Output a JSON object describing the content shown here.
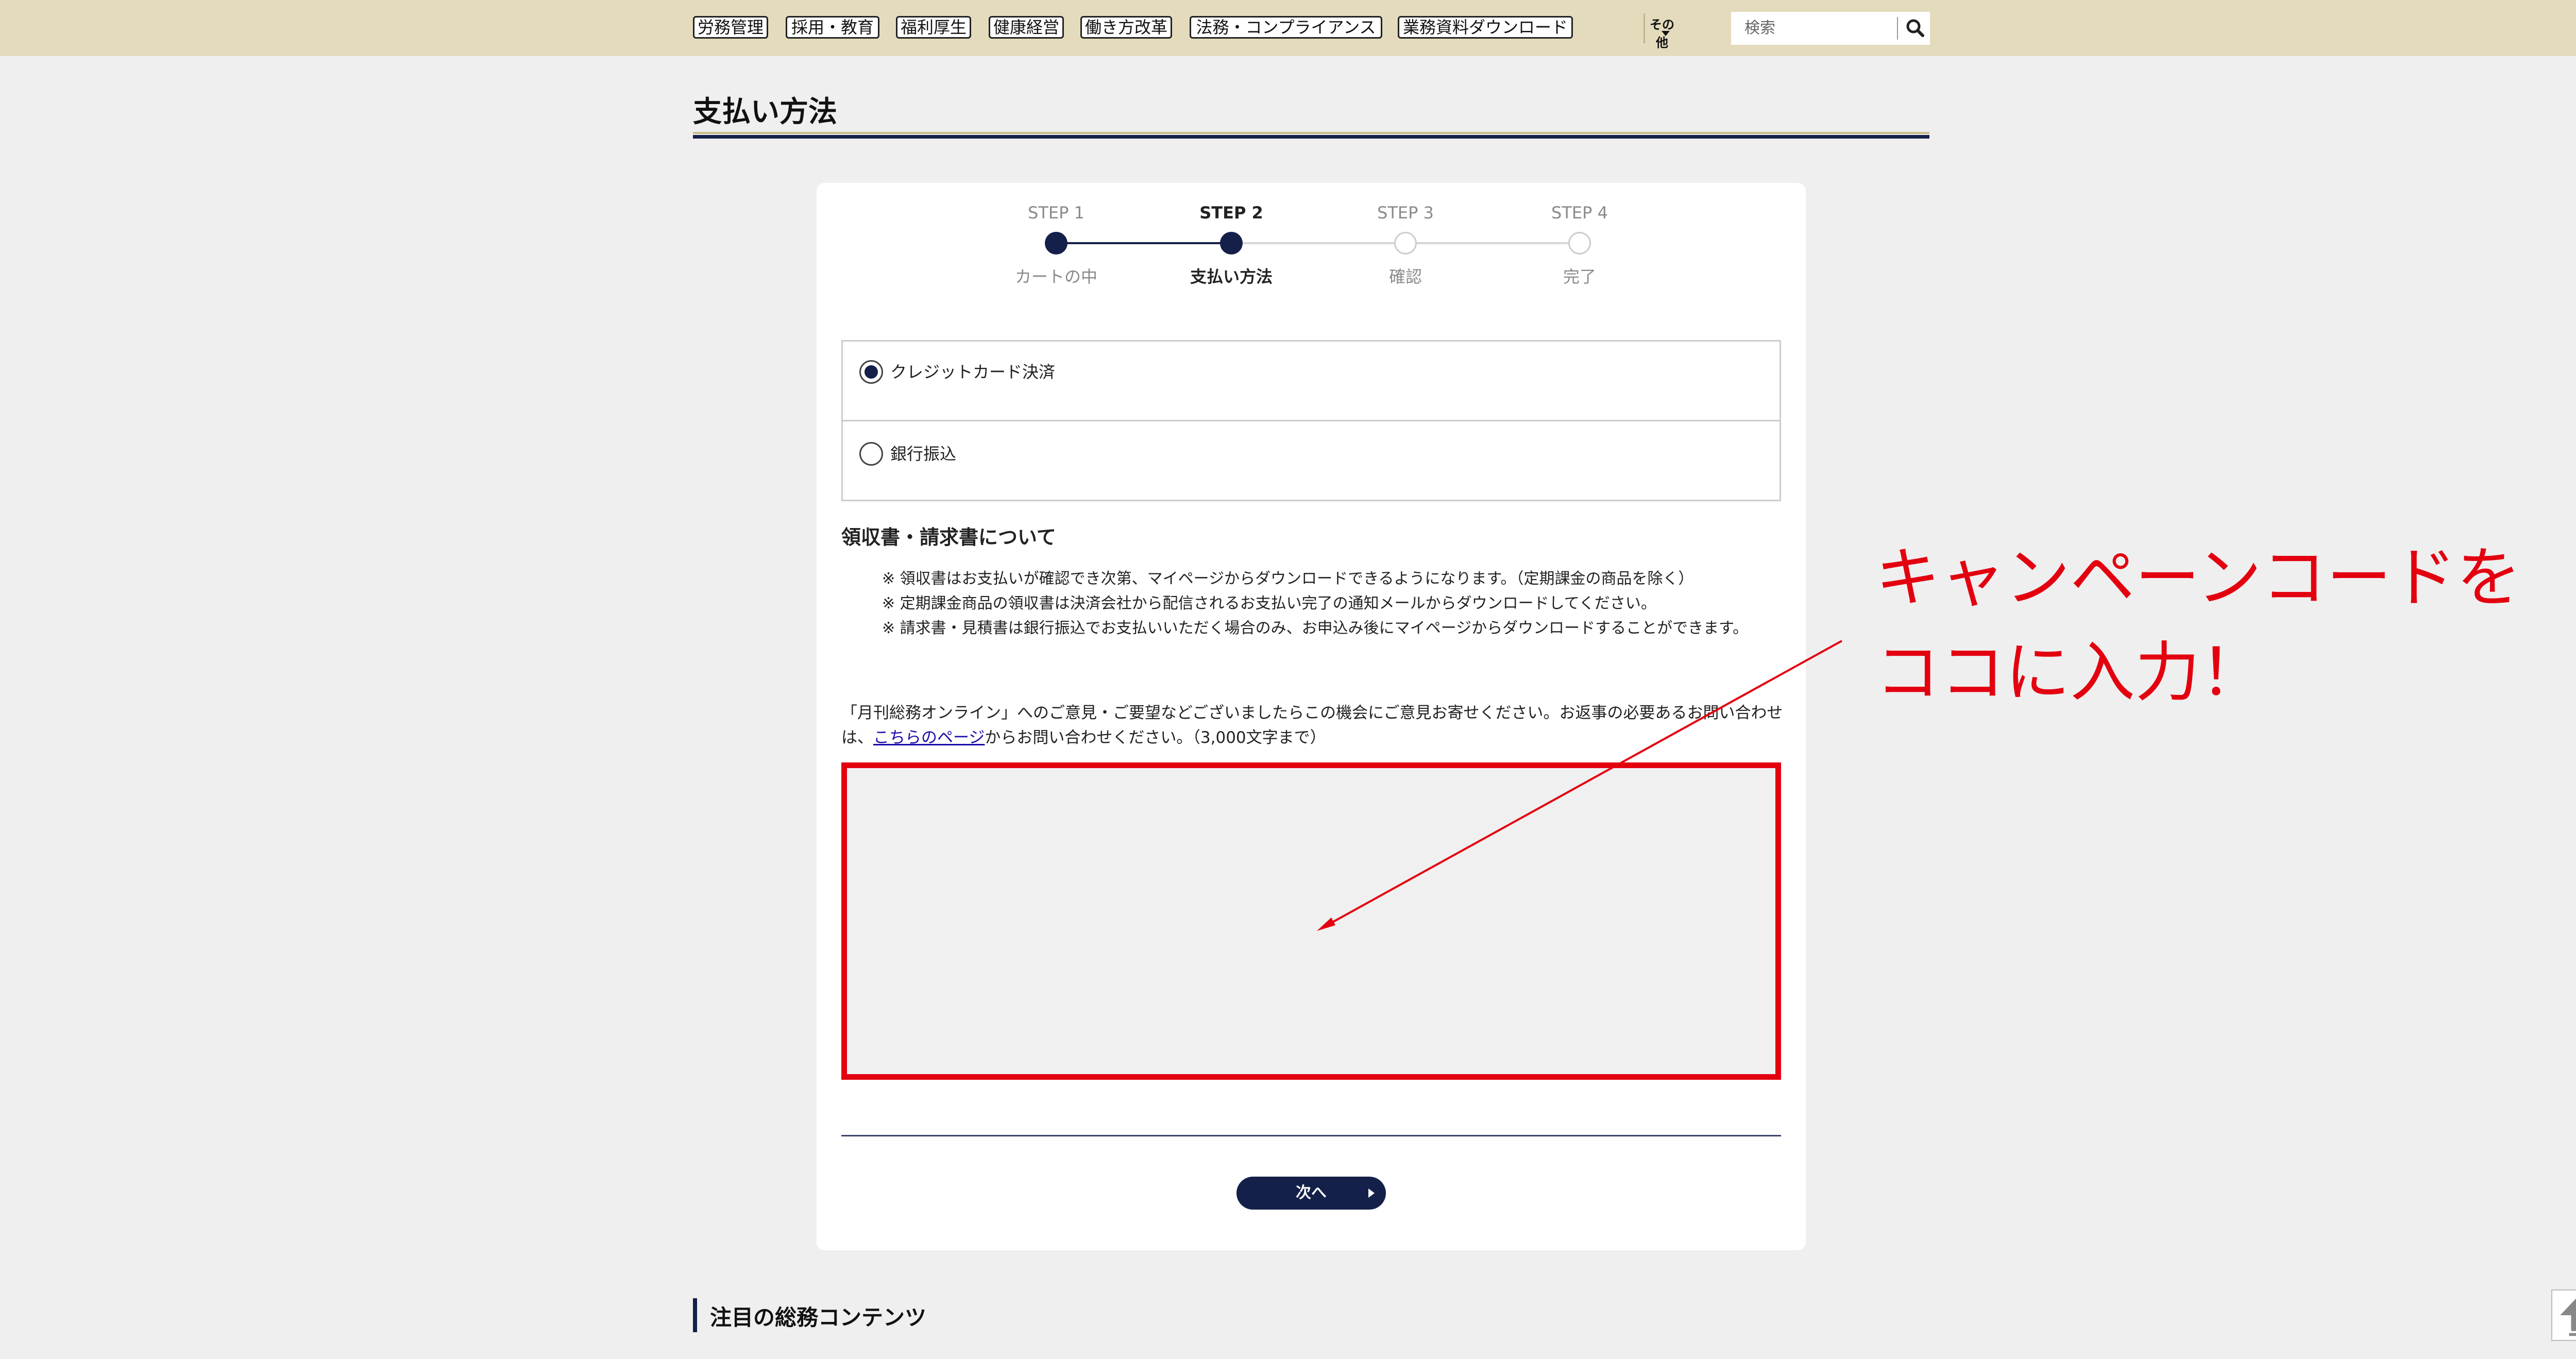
{
  "nav": {
    "items": [
      "労務管理",
      "採用・教育",
      "福利厚生",
      "健康経営",
      "働き方改革",
      "法務・コンプライアンス",
      "業務資料ダウンロード"
    ],
    "more_label": "その他",
    "search_placeholder": "検索"
  },
  "page": {
    "title": "支払い方法"
  },
  "steps": [
    {
      "label": "STEP 1",
      "name": "カートの中",
      "status": "done"
    },
    {
      "label": "STEP 2",
      "name": "支払い方法",
      "status": "current"
    },
    {
      "label": "STEP 3",
      "name": "確認",
      "status": "todo"
    },
    {
      "label": "STEP 4",
      "name": "完了",
      "status": "todo"
    }
  ],
  "payment": {
    "options": [
      {
        "label": "クレジットカード決済",
        "checked": true
      },
      {
        "label": "銀行振込",
        "checked": false
      }
    ]
  },
  "receipt": {
    "heading": "領収書・請求書について",
    "notes": [
      "※ 領収書はお支払いが確認でき次第、マイページからダウンロードできるようになります。（定期課金の商品を除く）",
      "※ 定期課金商品の領収書は決済会社から配信されるお支払い完了の通知メールからダウンロードしてください。",
      "※ 請求書・見積書は銀行振込でお支払いいただく場合のみ、お申込み後にマイページからダウンロードすることができます。"
    ]
  },
  "comment": {
    "intro_before": "「月刊総務オンライン」へのご意見・ご要望などございましたらこの機会にご意見お寄せください。お返事の必要あるお問い合わせは、",
    "link_text": "こちらのページ",
    "intro_after": "からお問い合わせください。（3,000文字まで）",
    "value": ""
  },
  "next_button": "次へ",
  "annotation": {
    "line1": "キャンペーンコードを",
    "line2": "ココに入力！",
    "color": "#e3000f"
  },
  "section": {
    "title": "注目の総務コンテンツ"
  },
  "colors": {
    "navy": "#14204a",
    "nav_bg": "#e3dbbc",
    "accent_red": "#e3000f"
  }
}
